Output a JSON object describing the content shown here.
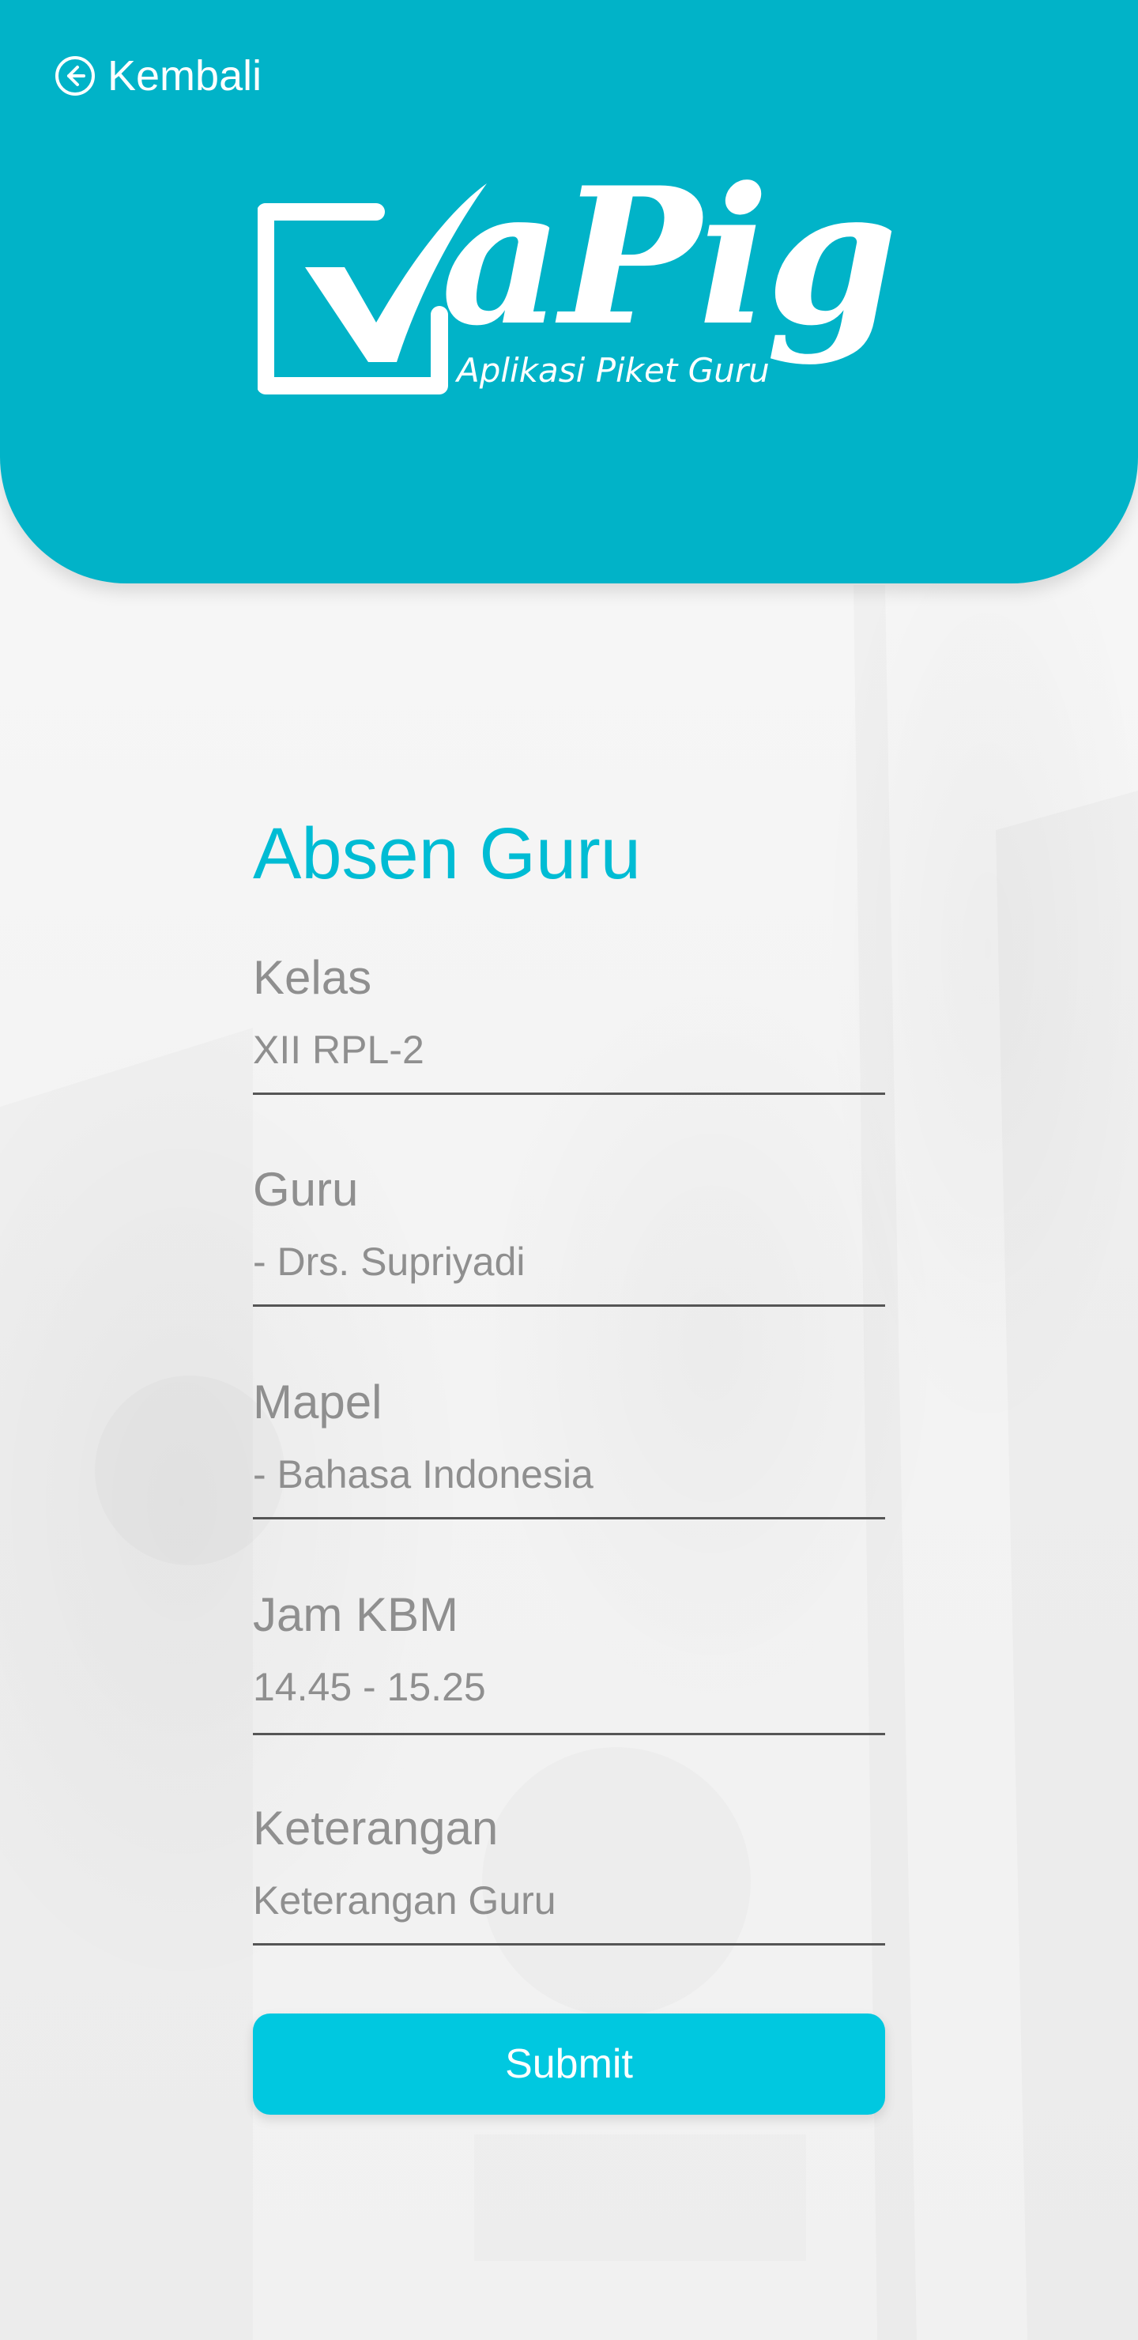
{
  "header": {
    "back_label": "Kembali",
    "back_icon": "arrow-left-circle-icon",
    "brand_color": "#01b3c8",
    "logo": {
      "wordmark": "aPig",
      "tagline": "Aplikasi Piket Guru",
      "mark_icon": "checkbox-check-icon"
    }
  },
  "form": {
    "title": "Absen Guru",
    "title_color": "#00bcd4",
    "fields": [
      {
        "label": "Kelas",
        "value": "XII RPL-2"
      },
      {
        "label": "Guru",
        "value": "- Drs. Supriyadi"
      },
      {
        "label": "Mapel",
        "value": "- Bahasa Indonesia"
      },
      {
        "label": "Jam KBM",
        "value": "14.45 - 15.25"
      },
      {
        "label": "Keterangan",
        "value": "",
        "placeholder": "Keterangan Guru"
      }
    ],
    "submit_label": "Submit",
    "submit_color": "#00c8e0"
  }
}
